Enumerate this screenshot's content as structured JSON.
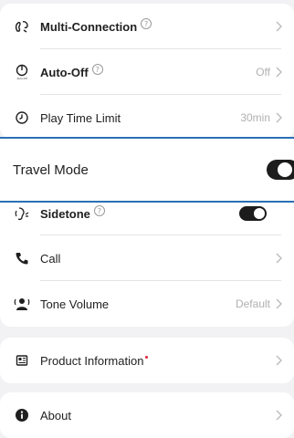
{
  "card_top": {
    "rows": [
      {
        "label": "Multi-Connection",
        "value": "",
        "icon": "multi-connection-icon"
      },
      {
        "label": "Auto-Off",
        "value": "Off",
        "icon": "auto-off-icon",
        "icon_caption": "Auto-Off"
      },
      {
        "label": "Play Time Limit",
        "value": "30min",
        "icon": "play-time-clock-icon"
      }
    ]
  },
  "travel_mode": {
    "label": "Travel Mode",
    "enabled": true
  },
  "card_mid": {
    "rows": [
      {
        "label": "Sidetone",
        "icon": "sidetone-icon",
        "enabled": true
      },
      {
        "label": "Call",
        "value": "",
        "icon": "phone-icon"
      },
      {
        "label": "Tone Volume",
        "value": "Default",
        "icon": "tone-volume-icon"
      }
    ]
  },
  "product_info": {
    "label": "Product Information",
    "icon": "product-info-icon",
    "has_badge": true
  },
  "about": {
    "label": "About",
    "icon": "info-icon"
  },
  "colors": {
    "accent_blue": "#2a6fb5",
    "toggle_on": "#1c1c1c",
    "badge_red": "#e0243a",
    "muted_text": "#b0b0b0"
  }
}
